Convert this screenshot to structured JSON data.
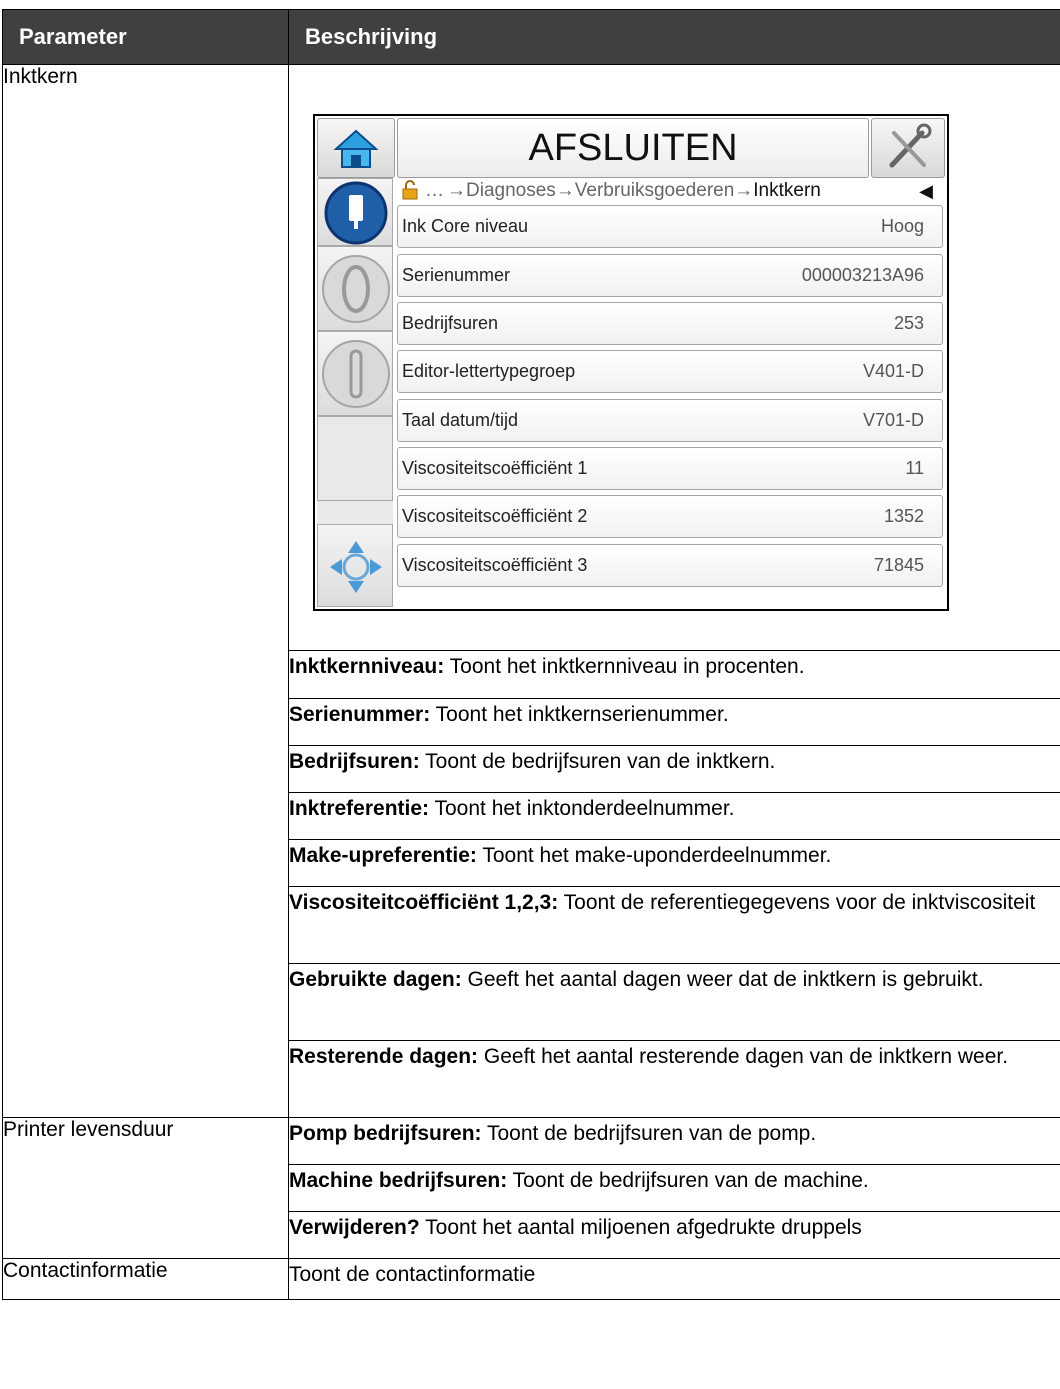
{
  "table": {
    "header_param": "Parameter",
    "header_desc": "Beschrijving"
  },
  "screen": {
    "title": "AFSLUITEN",
    "breadcrumb": {
      "ellipsis": "…",
      "items": [
        "Diagnoses",
        "Verbruiksgoederen",
        "Inktkern"
      ]
    },
    "rows": [
      {
        "label": "Ink Core niveau",
        "value": "Hoog"
      },
      {
        "label": "Serienummer",
        "value": "000003213A96"
      },
      {
        "label": "Bedrijfsuren",
        "value": "253"
      },
      {
        "label": "Editor-lettertypegroep",
        "value": "V401-D"
      },
      {
        "label": "Taal datum/tijd",
        "value": "V701-D"
      },
      {
        "label": "Viscositeitscoëfficiënt 1",
        "value": "11"
      },
      {
        "label": "Viscositeitscoëfficiënt 2",
        "value": "1352"
      },
      {
        "label": "Viscositeitscoëfficiënt 3",
        "value": "71845"
      }
    ]
  },
  "sections": [
    {
      "param": "Inktkern",
      "items": [
        {
          "term": "Inktkernniveau:",
          "text": " Toont het inktkernniveau in procenten."
        },
        {
          "term": "Serienummer:",
          "text": " Toont het inktkernserienummer."
        },
        {
          "term": "Bedrijfsuren:",
          "text": " Toont de bedrijfsuren van de inktkern."
        },
        {
          "term": "Inktreferentie:",
          "text": " Toont het inktonderdeelnummer."
        },
        {
          "term": "Make-upreferentie:",
          "text": " Toont het make-uponderdeelnummer."
        },
        {
          "term": "Viscositeitcoëfficiënt 1,2,3:",
          "text": " Toont de referentiegegevens voor de inktviscositeit"
        },
        {
          "term": "Gebruikte dagen:",
          "text": " Geeft het aantal dagen weer dat de inktkern is gebruikt."
        },
        {
          "term": "Resterende dagen:",
          "text": " Geeft het aantal resterende dagen van de inktkern weer."
        }
      ]
    },
    {
      "param": "Printer levensduur",
      "items": [
        {
          "term": "Pomp bedrijfsuren:",
          "text": " Toont de bedrijfsuren van de pomp."
        },
        {
          "term": "Machine bedrijfsuren:",
          "text": " Toont de bedrijfsuren van de machine."
        },
        {
          "term": "Verwijderen?",
          "text": " Toont het aantal miljoenen afgedrukte druppels"
        }
      ]
    },
    {
      "param": "Contactinformatie",
      "items": [
        {
          "term": "",
          "text": "Toont de contactinformatie"
        }
      ]
    }
  ]
}
